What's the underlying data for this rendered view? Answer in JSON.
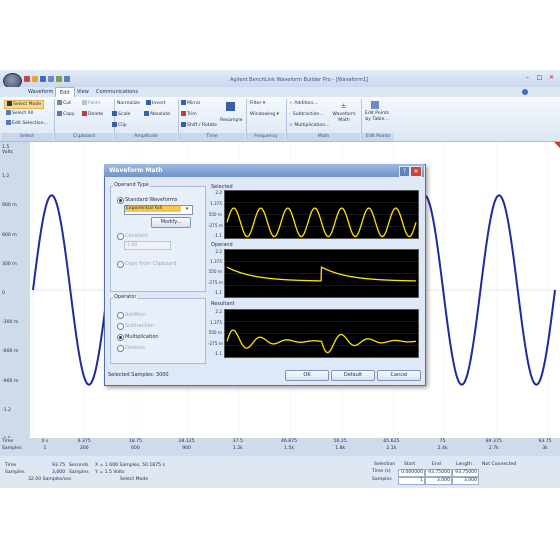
{
  "app": {
    "title": "Agilent BenchLink Waveform Builder Pro - [Waveform1]"
  },
  "tabs": [
    "Waveform",
    "Edit",
    "View",
    "Communications"
  ],
  "active_tab": "Edit",
  "ribbon": {
    "select": {
      "items": [
        "Select Mode",
        "Select All",
        "Edit Selection..."
      ],
      "group": "Select"
    },
    "clipboard": {
      "items": [
        "Cut",
        "Paste",
        "Copy",
        "Delete"
      ],
      "group": "Clipboard"
    },
    "amplitude": {
      "items": [
        "Normalize",
        "Invert",
        "Scale",
        "Absolute",
        "Clip"
      ],
      "group": "Amplitude"
    },
    "time": {
      "items": [
        "Mirror",
        "Trim",
        "Shift / Rotate",
        "Resample"
      ],
      "group": "Time"
    },
    "frequency": {
      "items": [
        "Filter",
        "Windowing"
      ],
      "group": "Frequency"
    },
    "math": {
      "items": [
        "Addition...",
        "Subtraction...",
        "Multiplication...",
        "Waveform Math"
      ],
      "group": "Math"
    },
    "editpoints": {
      "items": [
        "Edit Points by Table..."
      ],
      "group": "Edit Points"
    }
  },
  "plot": {
    "y_unit": "Volts",
    "y_ticks": [
      "1.5",
      "1.2",
      "900 m",
      "600 m",
      "300 m",
      "0",
      "-300 m",
      "-600 m",
      "-900 m",
      "-1.2",
      "-1.5"
    ],
    "x_row_labels": [
      "Time",
      "Samples"
    ],
    "x_time": [
      "0 s",
      "9.375",
      "18.75",
      "28.125",
      "37.5",
      "46.875",
      "56.25",
      "65.625",
      "75",
      "84.375",
      "93.75"
    ],
    "x_samples": [
      "1",
      "300",
      "600",
      "900",
      "1.2k",
      "1.5k",
      "1.8k",
      "2.1k",
      "2.4k",
      "2.7k",
      "3k"
    ],
    "trace_color": "#1f2a9c",
    "amplitude": 1.0,
    "cycles": 7
  },
  "status": {
    "time_label": "Time",
    "time_value": "93.75",
    "time_unit": "Seconds",
    "samples_label": "Samples",
    "samples_value": "3,000",
    "samples_unit": "Samples",
    "rate": "32.00 Samples/sec",
    "cursor_x": "X = 1.606 Samples, 50.1875 s",
    "cursor_y": "Y = 1.5 Volts",
    "mode": "Select Mode",
    "selection_label": "Selection",
    "sel_headers": [
      "Start",
      "End",
      "Length"
    ],
    "sel_row1_label": "Time (s)",
    "sel_row1": [
      "0.000000",
      "93.75000",
      "93.75000"
    ],
    "sel_row2_label": "Samples",
    "sel_row2": [
      "1",
      "3,000",
      "3,000"
    ],
    "connection": "Not Connected"
  },
  "dialog": {
    "title": "Waveform Math",
    "operand_type_label": "Operand Type",
    "standard_label": "Standard Waveforms",
    "standard_value": "Exponential Fall",
    "modify_button": "Modify...",
    "constant_label": "Constant",
    "constant_value": "1.00",
    "copy_label": "Copy from Clipboard",
    "operator_label": "Operator",
    "operators": [
      "Addition",
      "Subtraction",
      "Multiplication",
      "Division"
    ],
    "selected_operator": "Multiplication",
    "selected_samples": "Selected Samples: 3000",
    "ok": "OK",
    "default": "Default",
    "cancel": "Cancel",
    "panels": [
      {
        "name": "Selected",
        "ticks": [
          "2.2",
          "1.375",
          "550 m",
          "-275 m",
          "-1.1"
        ]
      },
      {
        "name": "Operand",
        "ticks": [
          "2.2",
          "1.375",
          "550 m",
          "-275 m",
          "-1.1"
        ]
      },
      {
        "name": "Resultant",
        "ticks": [
          "2.2",
          "1.375",
          "550 m",
          "-275 m",
          "-1.1"
        ]
      }
    ],
    "trace_color": "#ffe400"
  }
}
